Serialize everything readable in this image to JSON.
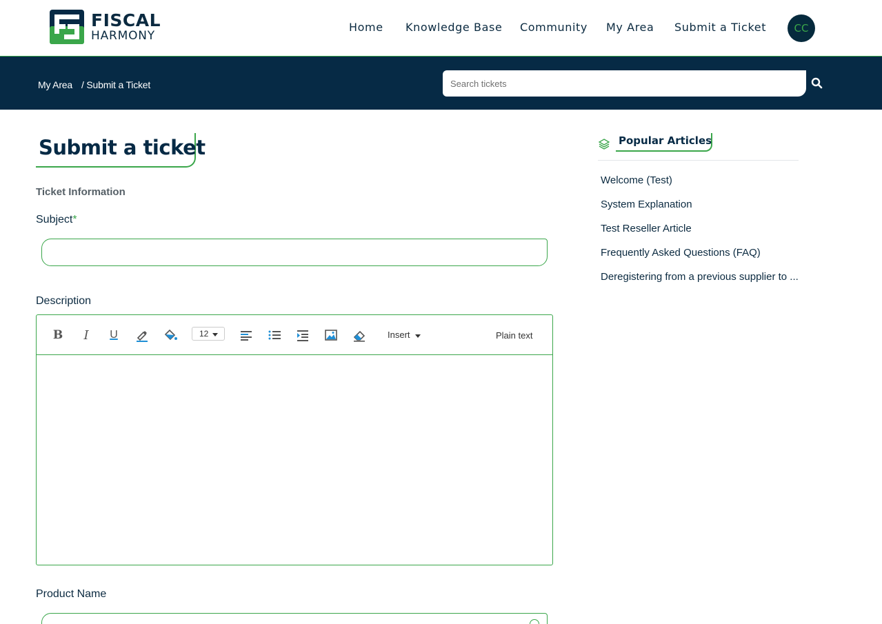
{
  "brand": {
    "name_line1": "FISCAL",
    "name_line2": "HARMONY",
    "colors": {
      "navy": "#062a45",
      "green": "#3aa64a"
    }
  },
  "nav": {
    "items": [
      {
        "label": "Home"
      },
      {
        "label": "Knowledge Base"
      },
      {
        "label": "Community"
      },
      {
        "label": "My Area"
      },
      {
        "label": "Submit a Ticket"
      }
    ],
    "avatar_initials": "CC"
  },
  "breadcrumb": {
    "items": [
      "My Area",
      "/ Submit a Ticket"
    ]
  },
  "search": {
    "placeholder": "Search tickets",
    "value": "",
    "icon": "search-icon"
  },
  "page": {
    "title": "Submit a ticket",
    "section_label": "Ticket Information",
    "subject": {
      "label": "Subject",
      "required_mark": "*",
      "value": ""
    },
    "description": {
      "label": "Description",
      "value": ""
    },
    "product": {
      "label": "Product Name",
      "value": ""
    }
  },
  "editor": {
    "bold": "B",
    "italic": "I",
    "underline": "U",
    "font_size": "12",
    "insert_label": "Insert",
    "plain_text_label": "Plain text",
    "icons": [
      "pen-color-icon",
      "fill-color-icon",
      "align-left-icon",
      "bullet-list-icon",
      "indent-icon",
      "image-icon",
      "eraser-icon"
    ]
  },
  "sidebar": {
    "title": "Popular Articles",
    "icon": "layers-icon",
    "articles": [
      "Welcome (Test)",
      "System Explanation",
      "Test Reseller Article",
      "Frequently Asked Questions (FAQ)",
      "Deregistering from a previous supplier to ..."
    ]
  }
}
